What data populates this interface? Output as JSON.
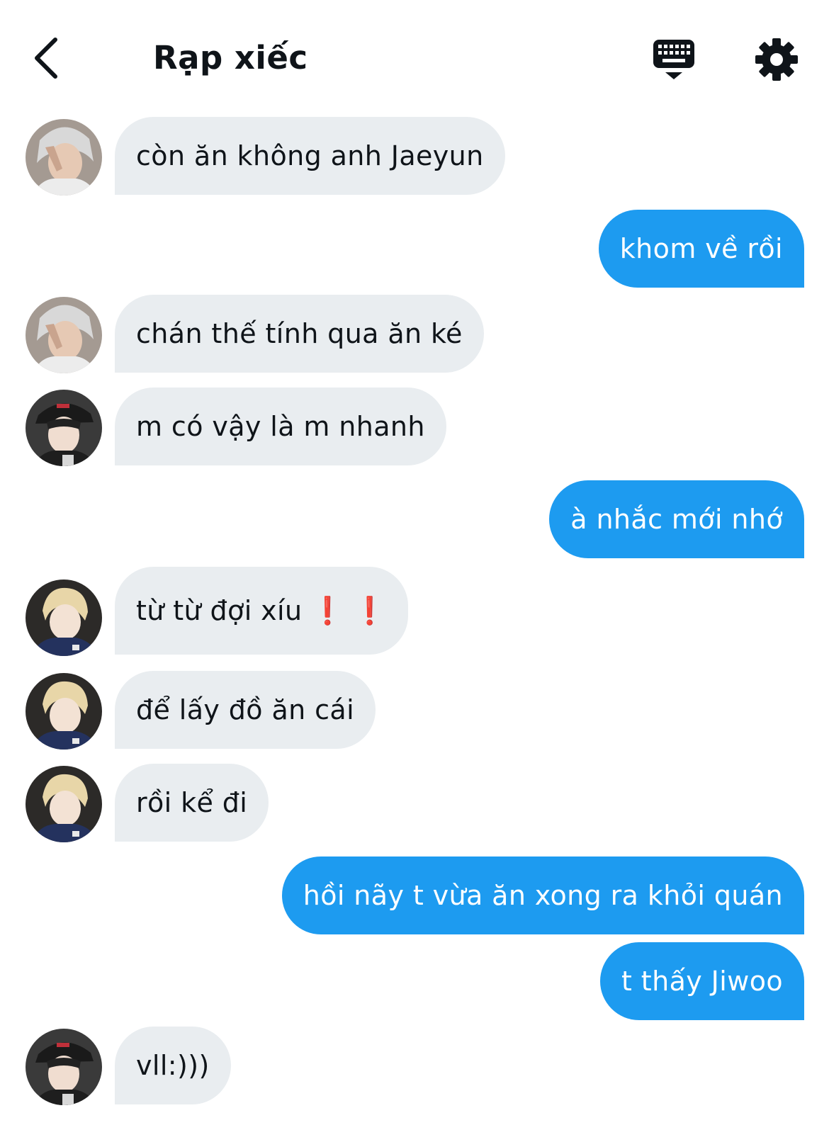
{
  "header": {
    "title": "Rạp xiếc",
    "back_icon": "chevron-left-icon",
    "keyboard_icon": "keyboard-icon",
    "settings_icon": "gear-icon"
  },
  "colors": {
    "outgoing_bubble": "#1d9bf0",
    "incoming_bubble": "#e9edf0"
  },
  "messages": [
    {
      "direction": "in",
      "avatar": "avatar-1",
      "text": "còn ăn không anh Jaeyun"
    },
    {
      "direction": "out",
      "text": "khom về rồi"
    },
    {
      "direction": "in",
      "avatar": "avatar-1",
      "text": "chán thế tính qua ăn ké"
    },
    {
      "direction": "in",
      "avatar": "avatar-2",
      "text": "m có vậy là m nhanh"
    },
    {
      "direction": "out",
      "text": "à nhắc mới nhớ"
    },
    {
      "direction": "in",
      "avatar": "avatar-3",
      "text": "từ từ đợi xíu",
      "emoji": "exclamation-mark-icon x2"
    },
    {
      "direction": "in",
      "avatar": "avatar-3",
      "text": "để lấy đồ ăn cái"
    },
    {
      "direction": "in",
      "avatar": "avatar-3",
      "text": "rồi kể đi"
    },
    {
      "direction": "out",
      "text": "hồi nãy t vừa ăn xong ra khỏi quán"
    },
    {
      "direction": "out",
      "text": "t thấy Jiwoo"
    },
    {
      "direction": "in",
      "avatar": "avatar-2",
      "text": "vll:)))"
    }
  ]
}
